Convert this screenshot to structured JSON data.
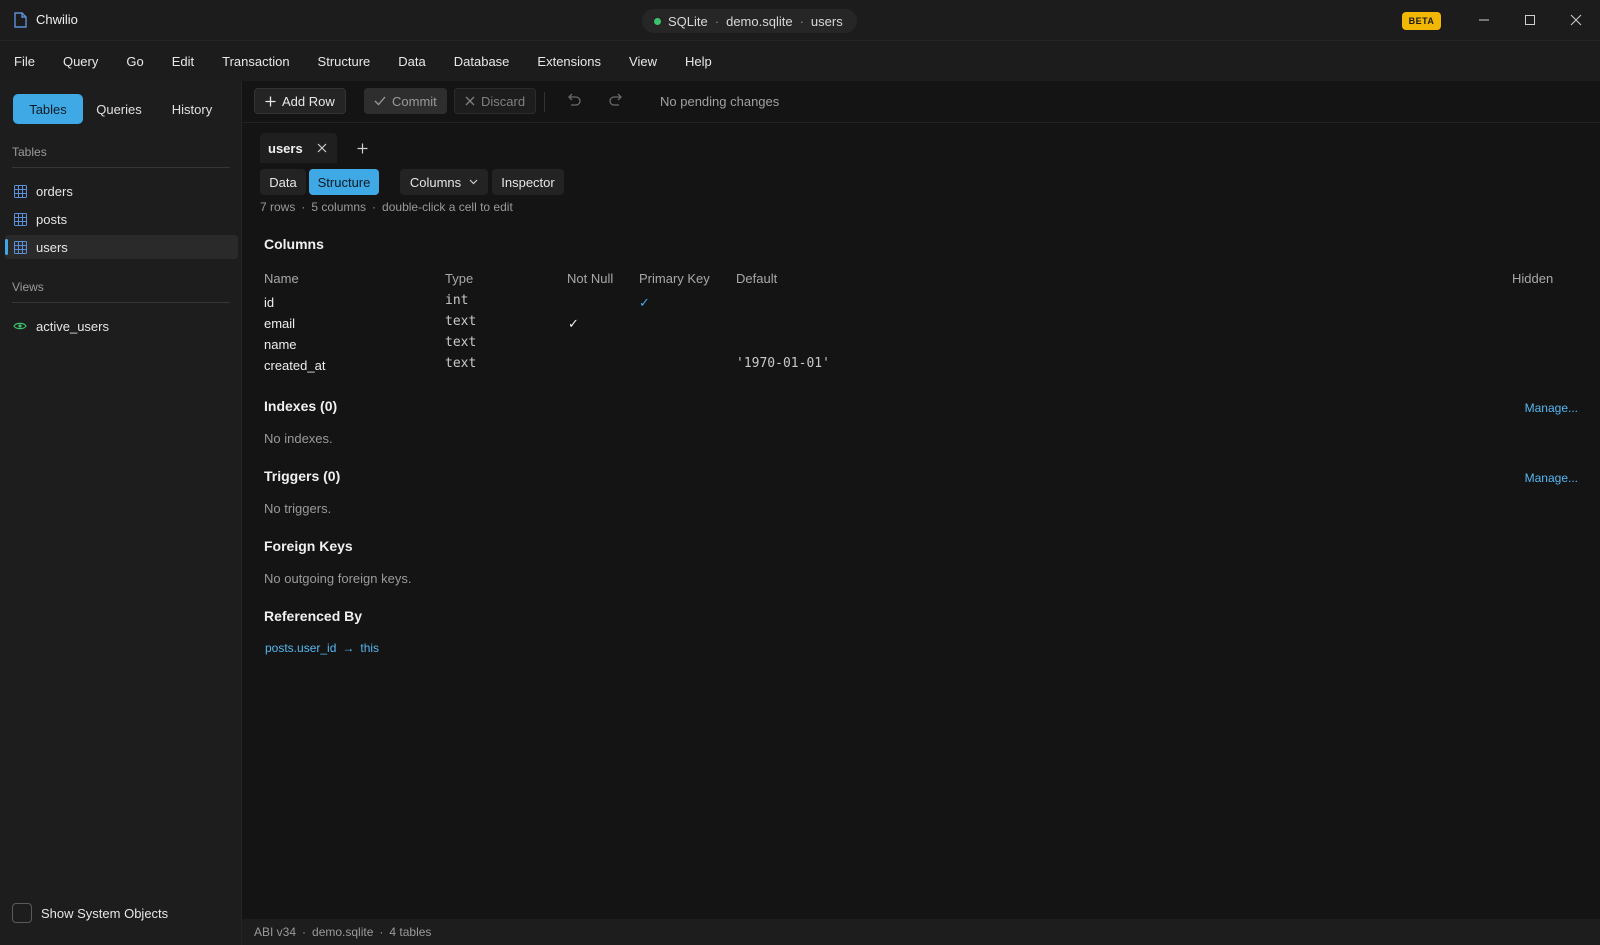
{
  "app": {
    "name": "Chwilio",
    "beta_label": "BETA"
  },
  "connection": {
    "engine": "SQLite",
    "file": "demo.sqlite",
    "table": "users",
    "status_color": "#3cc26a"
  },
  "menu": [
    "File",
    "Query",
    "Go",
    "Edit",
    "Transaction",
    "Structure",
    "Data",
    "Database",
    "Extensions",
    "View",
    "Help"
  ],
  "sidebar": {
    "tabs": [
      "Tables",
      "Queries",
      "History"
    ],
    "active_tab": "Tables",
    "tables_heading": "Tables",
    "tables": [
      "orders",
      "posts",
      "users"
    ],
    "selected_table": "users",
    "views_heading": "Views",
    "views": [
      "active_users"
    ],
    "show_system_label": "Show System Objects"
  },
  "toolbar": {
    "add_row": "Add Row",
    "commit": "Commit",
    "discard": "Discard",
    "pending": "No pending changes"
  },
  "doc_tab": {
    "label": "users"
  },
  "view_tabs": {
    "data": "Data",
    "structure": "Structure",
    "columns": "Columns",
    "inspector": "Inspector"
  },
  "meta": {
    "rows": "7 rows",
    "columns": "5 columns",
    "hint": "double-click a cell to edit",
    "sep": "·"
  },
  "structure": {
    "columns_heading": "Columns",
    "headers": {
      "name": "Name",
      "type": "Type",
      "not_null": "Not Null",
      "primary_key": "Primary Key",
      "default": "Default",
      "hidden": "Hidden"
    },
    "rows": [
      {
        "name": "id",
        "type": "int",
        "not_null": "",
        "primary_key": "✓",
        "default": ""
      },
      {
        "name": "email",
        "type": "text",
        "not_null": "✓",
        "primary_key": "",
        "default": ""
      },
      {
        "name": "name",
        "type": "text",
        "not_null": "",
        "primary_key": "",
        "default": ""
      },
      {
        "name": "created_at",
        "type": "text",
        "not_null": "",
        "primary_key": "",
        "default": "'1970-01-01'"
      }
    ],
    "indexes_heading": "Indexes (0)",
    "indexes_empty": "No indexes.",
    "triggers_heading": "Triggers (0)",
    "triggers_empty": "No triggers.",
    "manage_label": "Manage...",
    "fk_heading": "Foreign Keys",
    "fk_empty": "No outgoing foreign keys.",
    "refby_heading": "Referenced By",
    "refby": {
      "source": "posts.user_id",
      "arrow": "→",
      "target": "this"
    }
  },
  "statusbar": {
    "abi": "ABI v34",
    "file": "demo.sqlite",
    "tables": "4 tables",
    "sep": "·"
  },
  "colors": {
    "accent": "#3fa9e6",
    "link": "#55b7f0",
    "beta": "#f2b705"
  }
}
